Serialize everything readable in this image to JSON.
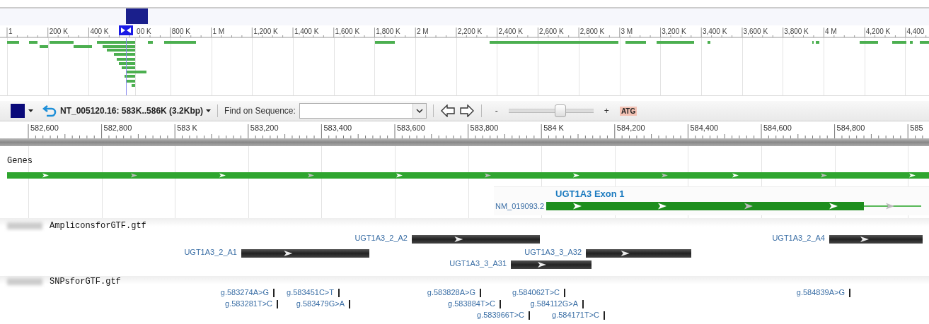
{
  "overview": {
    "ruler_labels": [
      "1",
      "200 K",
      "400 K",
      "00 K",
      "800 K",
      "1 M",
      "1,200 K",
      "1,400 K",
      "1,600 K",
      "1,800 K",
      "2 M",
      "2,200 K",
      "2,400 K",
      "2,600 K",
      "2,800 K",
      "3 M",
      "3,200 K",
      "3,400 K",
      "3,600 K",
      "3,800 K",
      "4 M",
      "4,200 K",
      "4,400"
    ]
  },
  "toolbar": {
    "location": "NT_005120.16: 583K..586K (3.2Kbp)",
    "find_label": "Find on Sequence:",
    "zoom_out": "-",
    "zoom_in": "+",
    "zoom": {
      "level": 0.6
    },
    "sequence_button": "ATG"
  },
  "ruler_labels": [
    "582,600",
    "582,800",
    "583 K",
    "583,200",
    "583,400",
    "583,600",
    "583,800",
    "584 K",
    "584,200",
    "584,400",
    "584,600",
    "584,800",
    "585"
  ],
  "tracks": [
    {
      "kind": "genes",
      "name": "Genes",
      "features": [
        {
          "name": "UGT1A3 Exon 1",
          "transcript": "NM_019093.2"
        }
      ]
    },
    {
      "kind": "amplicons",
      "name": "AmpliconsforGTF.gtf",
      "features": [
        {
          "label": "UGT1A3_2_A2"
        },
        {
          "label": "UGT1A3_2_A4"
        },
        {
          "label": "UGT1A3_2_A1"
        },
        {
          "label": "UGT1A3_3_A32"
        },
        {
          "label": "UGT1A3_3_A31"
        }
      ]
    },
    {
      "kind": "snps",
      "name": "SNPsforGTF.gtf",
      "features": [
        {
          "label": "g.583274A>G"
        },
        {
          "label": "g.583281T>C"
        },
        {
          "label": "g.583451C>T"
        },
        {
          "label": "g.583479G>A"
        },
        {
          "label": "g.583828A>G"
        },
        {
          "label": "g.583884T>C"
        },
        {
          "label": "g.583966T>C"
        },
        {
          "label": "g.584062T>C"
        },
        {
          "label": "g.584112G>A"
        },
        {
          "label": "g.584171T>C"
        },
        {
          "label": "g.584839A>G"
        }
      ]
    }
  ]
}
